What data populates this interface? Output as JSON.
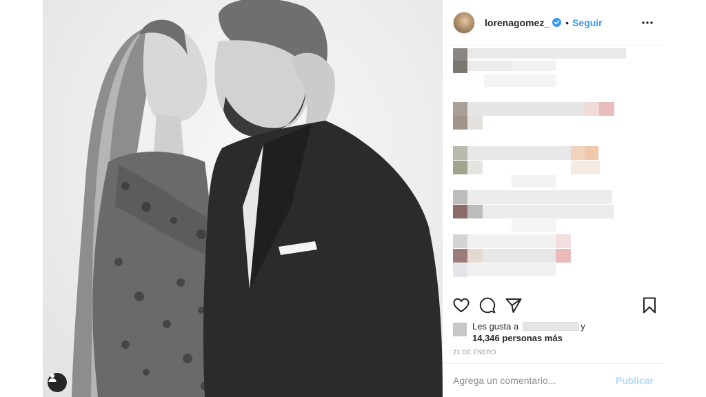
{
  "post": {
    "image_alt": "Black and white photo of a couple embracing",
    "tag_icon": "user-tag-icon"
  },
  "header": {
    "username": "lorenagomez_",
    "verified": true,
    "separator": "•",
    "follow_label": "Seguir",
    "more_icon": "more-options-icon"
  },
  "actions": {
    "like_icon": "heart-icon",
    "comment_icon": "comment-icon",
    "share_icon": "share-icon",
    "save_icon": "bookmark-icon"
  },
  "likes": {
    "prefix": "Les gusta a",
    "conjunction": "y",
    "count_text": "14,346 personas más"
  },
  "date": "21 DE ENERO",
  "comment_box": {
    "placeholder": "Agrega un comentario...",
    "publish_label": "Publicar"
  },
  "colors": {
    "accent": "#3897f0",
    "publish_disabled": "#b3dbff",
    "text": "#262626",
    "muted": "#8e8e8e",
    "divider": "#efefef"
  }
}
